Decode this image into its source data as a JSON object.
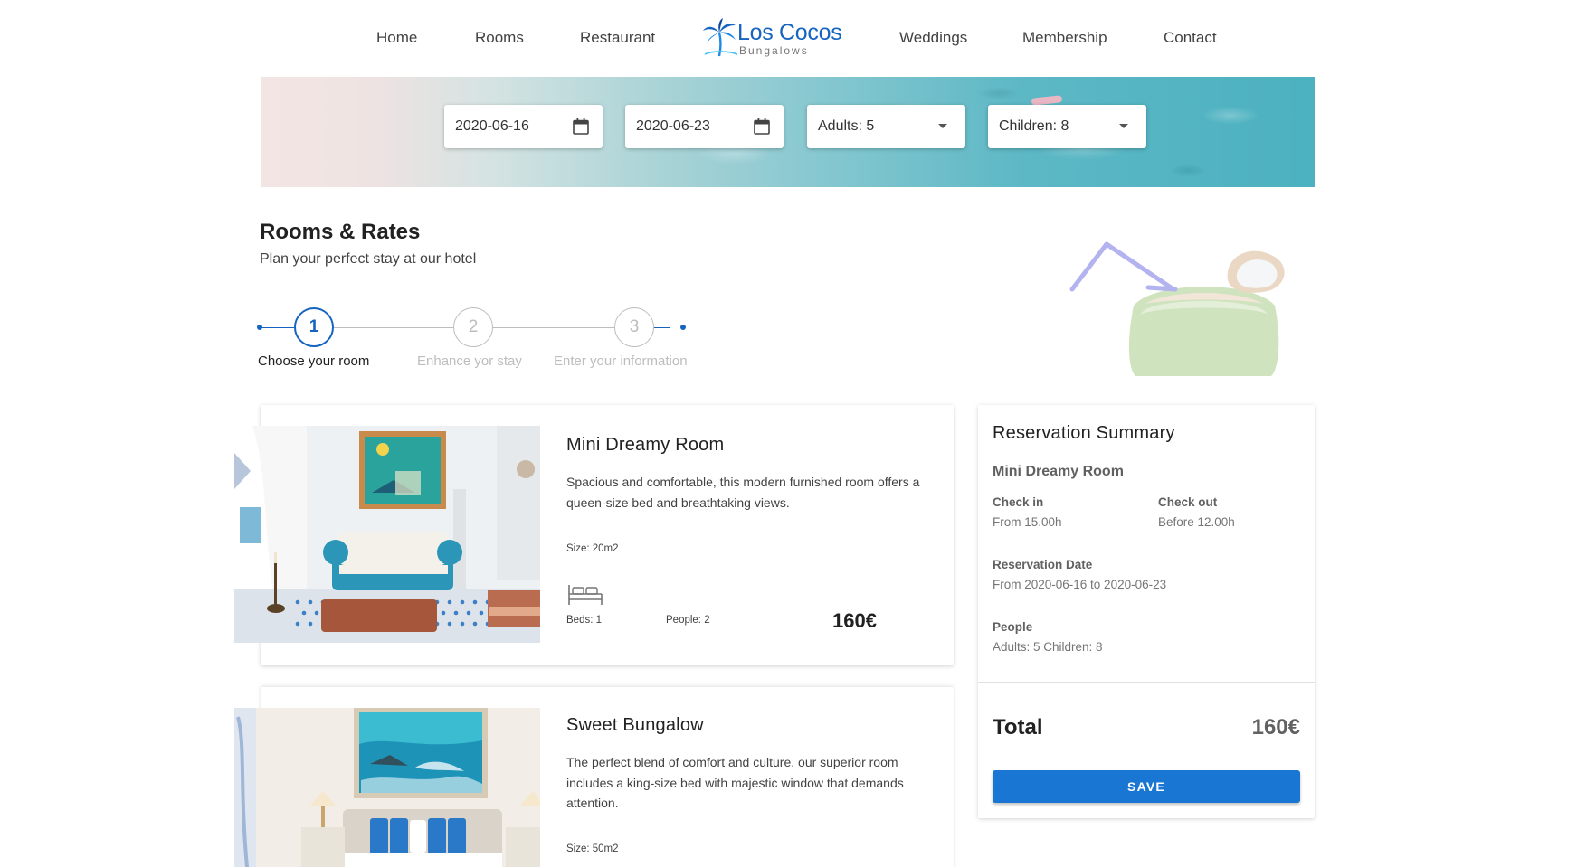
{
  "nav": {
    "links": [
      "Home",
      "Rooms",
      "Restaurant",
      "Weddings",
      "Membership",
      "Contact"
    ],
    "logo": {
      "name": "Los Cocos",
      "subtitle": "Bungalows",
      "icon": "palm-tree-icon"
    }
  },
  "search": {
    "check_in": "2020-06-16",
    "check_out": "2020-06-23",
    "adults": "Adults: 5",
    "children": "Children: 8"
  },
  "page": {
    "title": "Rooms & Rates",
    "subtitle": "Plan your perfect stay at our hotel"
  },
  "stepper": {
    "current_step": 1,
    "steps": [
      {
        "number": "1",
        "label": "Choose your room"
      },
      {
        "number": "2",
        "label": "Enhance yor stay"
      },
      {
        "number": "3",
        "label": "Enter your information"
      }
    ]
  },
  "rooms": [
    {
      "name": "Mini Dreamy Room",
      "description": "Spacious and comfortable, this modern furnished room offers a queen-size bed and breathtaking views.",
      "size": "Size: 20m2",
      "beds": "Beds: 1",
      "people": "People: 2",
      "price": "160€"
    },
    {
      "name": "Sweet Bungalow",
      "description": "The perfect blend of comfort and culture, our superior room includes a king-size bed with majestic window that demands attention.",
      "size": "Size: 50m2"
    }
  ],
  "summary": {
    "title": "Reservation Summary",
    "room": "Mini Dreamy Room",
    "check_in_label": "Check in",
    "check_in_value": "From 15.00h",
    "check_out_label": "Check out",
    "check_out_value": "Before 12.00h",
    "date_label": "Reservation Date",
    "date_value": "From 2020-06-16 to 2020-06-23",
    "people_label": "People",
    "people_value": "Adults: 5 Children: 8",
    "total_label": "Total",
    "total_value": "160€",
    "save_label": "SAVE"
  },
  "colors": {
    "primary": "#1565c0",
    "button": "#1976d2",
    "step_inactive": "#bdbdbd"
  }
}
